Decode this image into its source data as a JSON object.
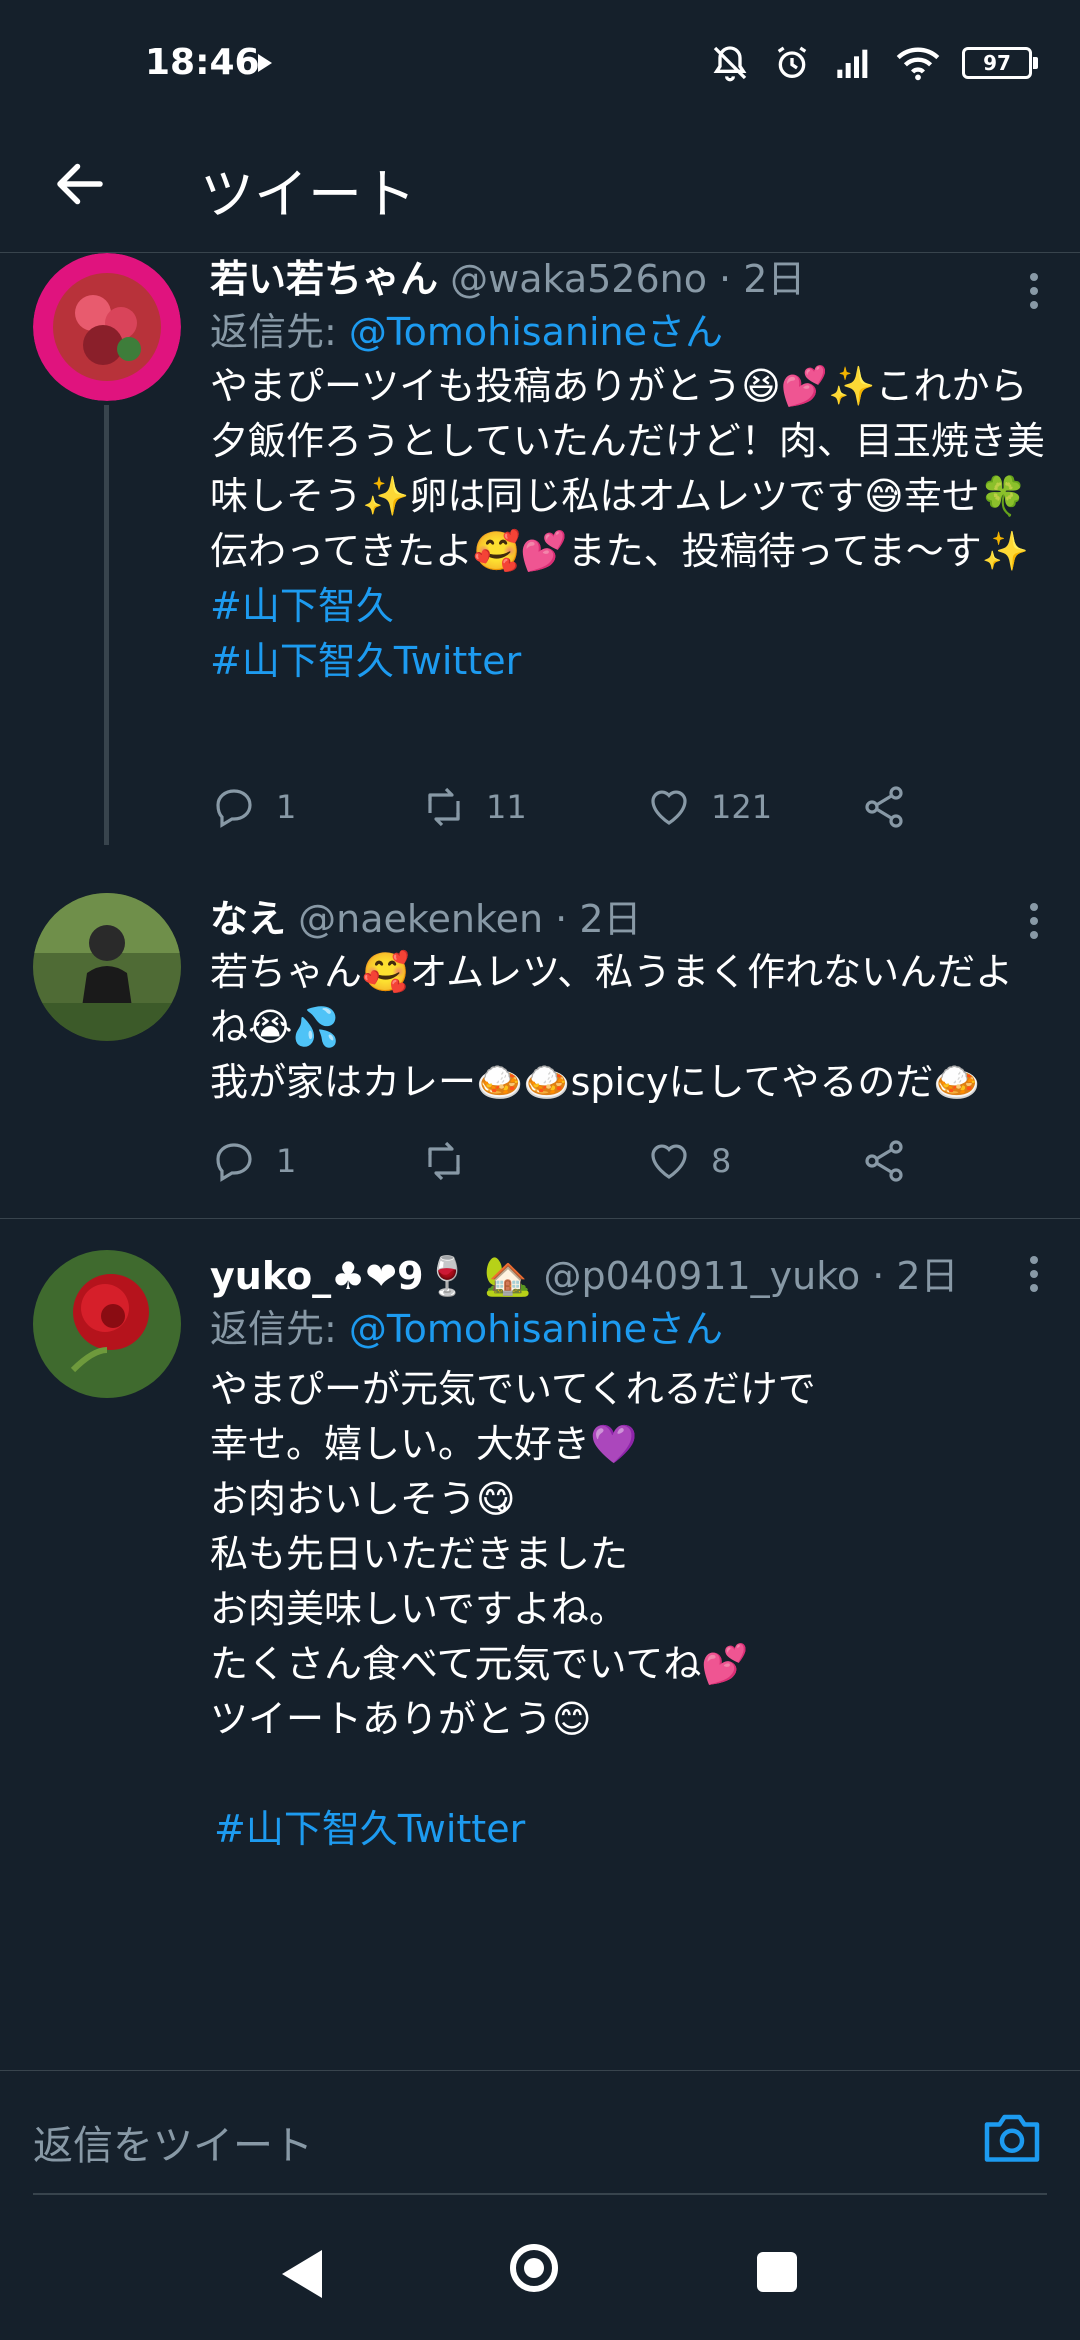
{
  "status_bar": {
    "time": "18:46",
    "battery": "97"
  },
  "header": {
    "title": "ツイート"
  },
  "tweets": [
    {
      "name": "若い若ちゃん",
      "handle": "@waka526no · 2日",
      "reply_prefix": "返信先: ",
      "reply_to": "@Tomohisanineさん",
      "body": "やまぴーツイも投稿ありがとう😆💕✨これから夕飯作ろうとしていたんだけど！肉、目玉焼き美味しそう✨卵は同じ私はオムレツです😅幸せ🍀伝わってきたよ🥰💕また、投稿待ってま〜す✨",
      "hashtags": [
        "#山下智久",
        "#山下智久Twitter"
      ],
      "replies": "1",
      "retweets": "11",
      "likes": "121"
    },
    {
      "name": "なえ",
      "handle": "@naekenken · 2日",
      "body": "若ちゃん🥰オムレツ、私うまく作れないんだよね😭💦\n我が家はカレー🍛🍛spicyにしてやるのだ🍛",
      "replies": "1",
      "retweets": "",
      "likes": "8"
    },
    {
      "name": "yuko_♣❤9🍷 🏡",
      "handle": "@p040911_yuko · 2日",
      "reply_prefix": "返信先: ",
      "reply_to": "@Tomohisanineさん",
      "body": "やまぴーが元気でいてくれるだけで\n幸せ。嬉しい。大好き💜\nお肉おいしそう😋\n私も先日いただきました\nお肉美味しいですよね。\nたくさん食べて元気でいてね💕\nツイートありがとう😊",
      "hashtags": [
        "#山下智久Twitter"
      ]
    }
  ],
  "reply_bar": {
    "placeholder": "返信をツイート"
  },
  "colors": {
    "background": "#15202b",
    "accent": "#1d9bf0",
    "muted": "#8899a6",
    "divider": "#38444d"
  }
}
